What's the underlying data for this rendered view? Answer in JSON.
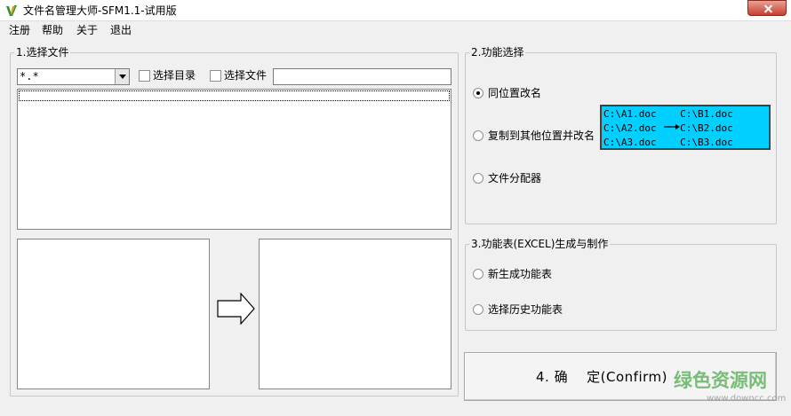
{
  "window": {
    "title": "文件名管理大师-SFM1.1-试用版"
  },
  "menu": {
    "items": [
      "注册",
      "帮助",
      "关于",
      "退出"
    ]
  },
  "section1": {
    "title": "1.选择文件",
    "filter_value": "*.*",
    "checkbox_dir_label": "选择目录",
    "checkbox_file_label": "选择文件",
    "path_input_value": ""
  },
  "section2": {
    "title": "2.功能选择",
    "options": [
      {
        "label": "同位置改名",
        "checked": true
      },
      {
        "label": "复制到其他位置并改名",
        "checked": false
      },
      {
        "label": "文件分配器",
        "checked": false
      }
    ],
    "demo": {
      "lines": [
        "C:\\A1.doc    C:\\B1.doc",
        "C:\\A2.doc    C:\\B2.doc",
        "C:\\A3.doc    C:\\B3.doc"
      ],
      "bg_color": "#00cfff"
    }
  },
  "section3": {
    "title": "3.功能表(EXCEL)生成与制作",
    "options": [
      {
        "label": "新生成功能表",
        "checked": false
      },
      {
        "label": "选择历史功能表",
        "checked": false
      }
    ]
  },
  "confirm": {
    "label": "4. 确    定(Confirm)"
  },
  "watermark": {
    "text": "绿色资源网",
    "url": "www.downcc.com",
    "color": "#58af58"
  }
}
